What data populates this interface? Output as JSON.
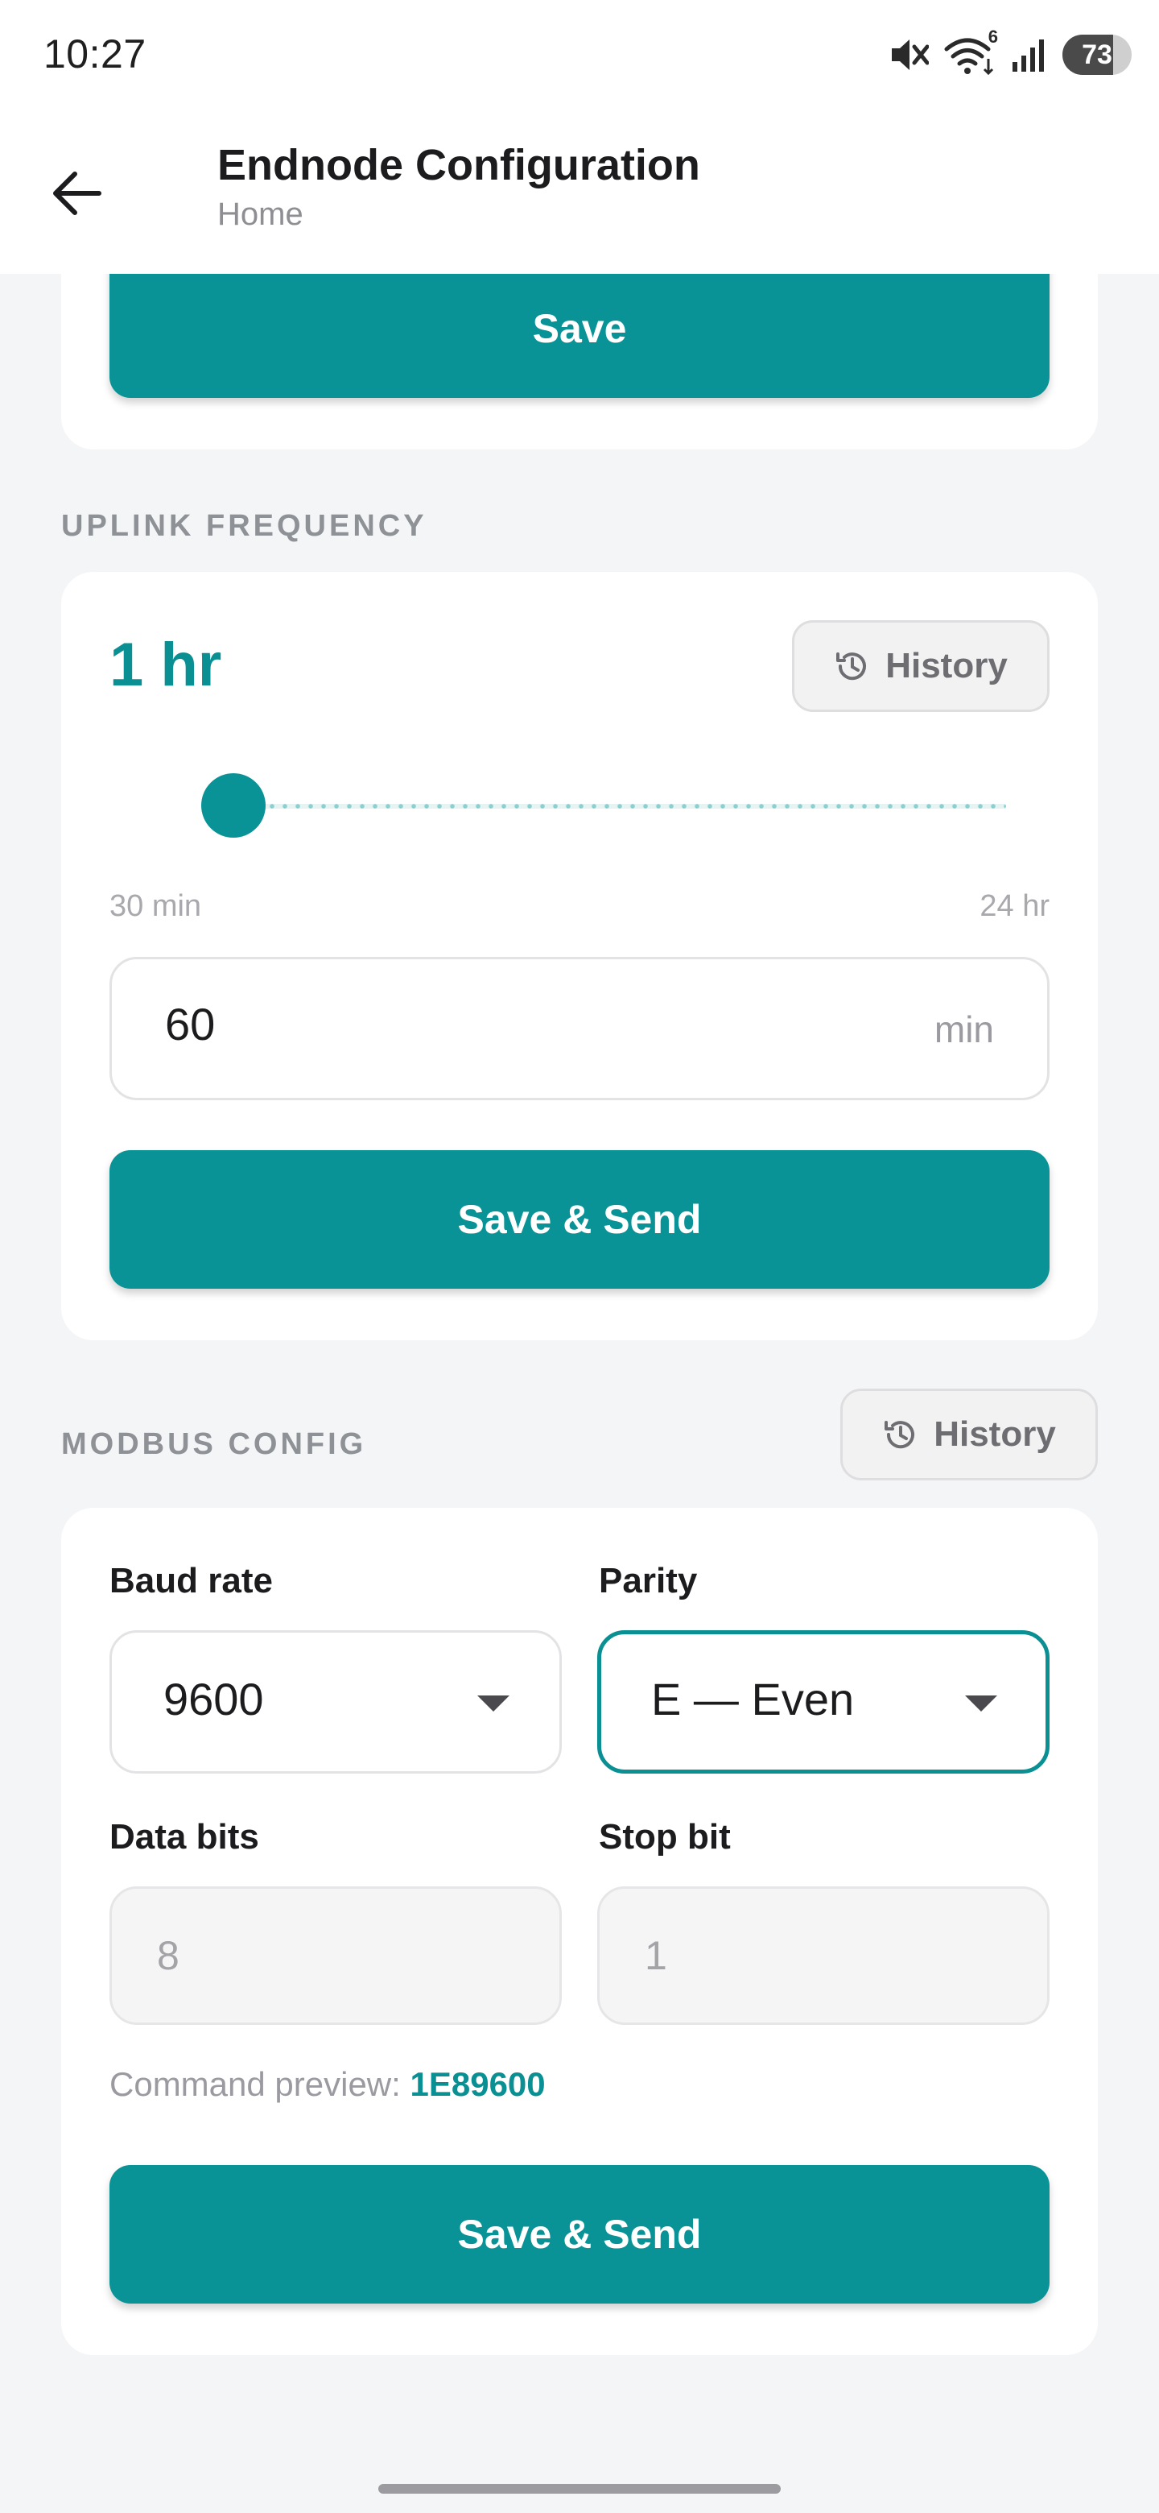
{
  "status_bar": {
    "time": "10:27",
    "battery": "73",
    "wifi_badge": "6"
  },
  "app_bar": {
    "title": "Endnode Configuration",
    "subtitle": "Home"
  },
  "top_card": {
    "save_label": "Save"
  },
  "uplink": {
    "section_label": "UPLINK FREQUENCY",
    "value_display": "1 hr",
    "history_label": "History",
    "slider": {
      "min_label": "30 min",
      "max_label": "24 hr",
      "position": 0.0
    },
    "input_value": "60",
    "input_suffix": "min",
    "save_send_label": "Save & Send"
  },
  "modbus": {
    "section_label": "MODBUS CONFIG",
    "history_label": "History",
    "baud_rate": {
      "label": "Baud rate",
      "value": "9600"
    },
    "parity": {
      "label": "Parity",
      "value": "E — Even"
    },
    "data_bits": {
      "label": "Data bits",
      "value": "8"
    },
    "stop_bit": {
      "label": "Stop bit",
      "value": "1"
    },
    "preview_label": "Command preview:",
    "preview_value": "1E89600",
    "save_send_label": "Save & Send"
  },
  "colors": {
    "accent": "#0a9396",
    "background": "#f4f5f7",
    "card": "#ffffff"
  },
  "icons": [
    "arrow-left-icon",
    "history-icon",
    "chevron-down-icon",
    "mute-icon",
    "wifi-icon",
    "signal-icon",
    "battery-icon"
  ]
}
